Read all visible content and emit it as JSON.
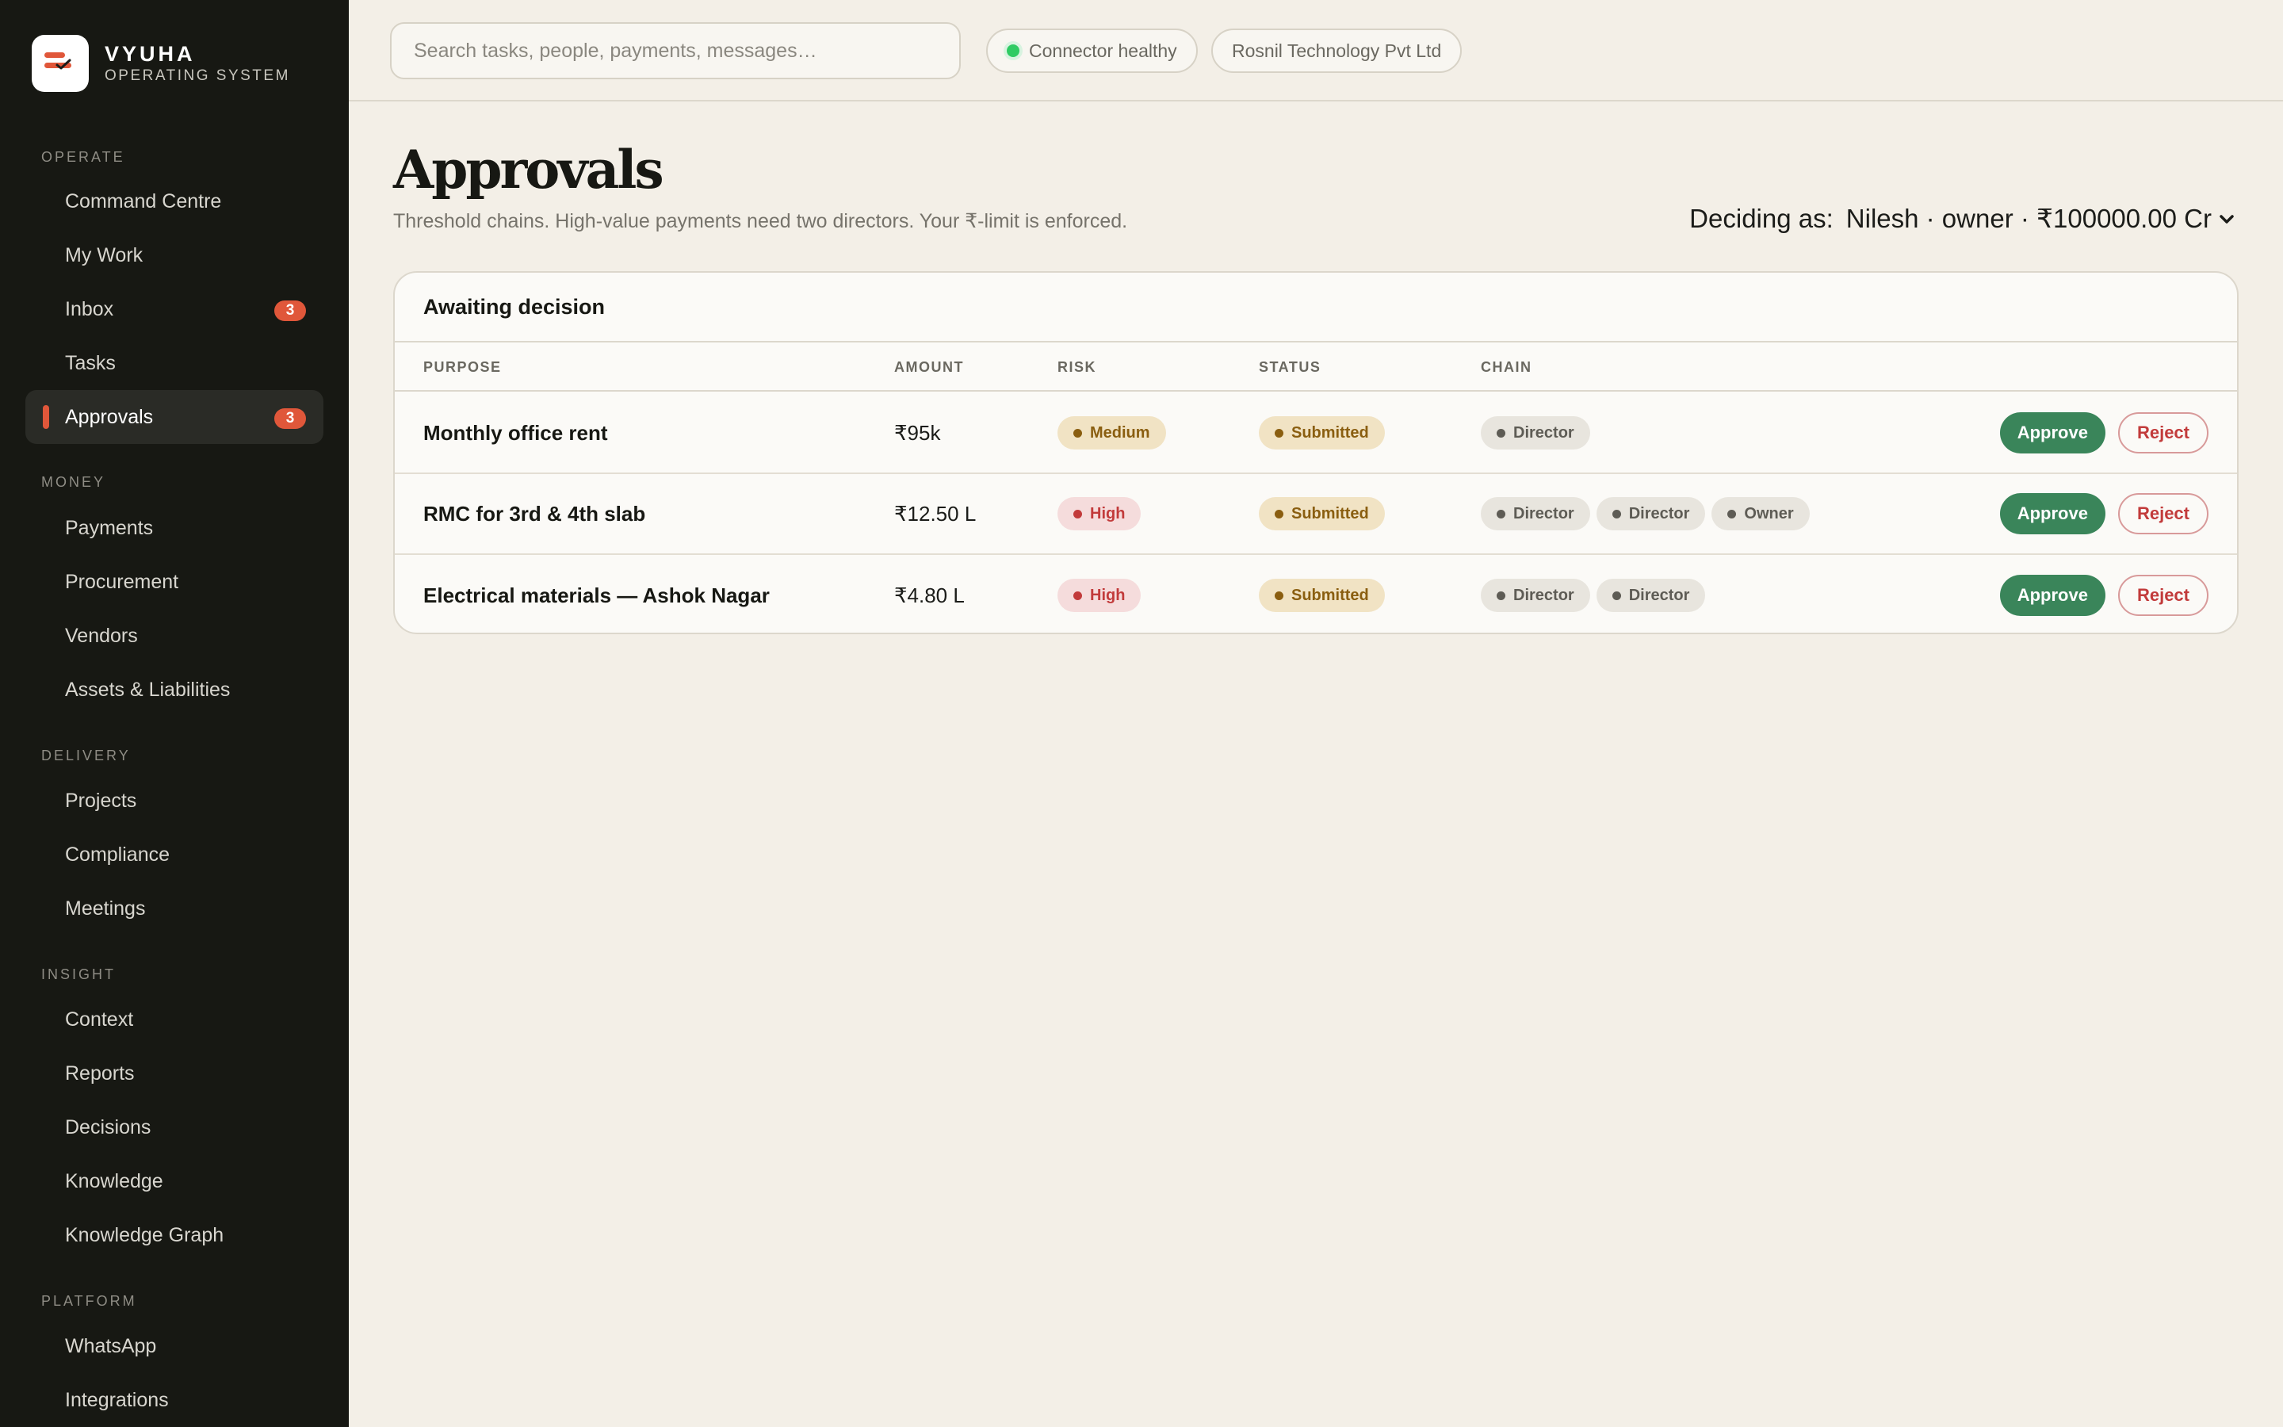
{
  "brand": {
    "name": "VYUHA",
    "subtitle": "OPERATING SYSTEM"
  },
  "sidebar": {
    "sections": [
      {
        "title": "OPERATE",
        "items": [
          {
            "label": "Command Centre"
          },
          {
            "label": "My Work"
          },
          {
            "label": "Inbox",
            "badge": "3"
          },
          {
            "label": "Tasks"
          },
          {
            "label": "Approvals",
            "badge": "3",
            "active": true
          }
        ]
      },
      {
        "title": "MONEY",
        "items": [
          {
            "label": "Payments"
          },
          {
            "label": "Procurement"
          },
          {
            "label": "Vendors"
          },
          {
            "label": "Assets & Liabilities"
          }
        ]
      },
      {
        "title": "DELIVERY",
        "items": [
          {
            "label": "Projects"
          },
          {
            "label": "Compliance"
          },
          {
            "label": "Meetings"
          }
        ]
      },
      {
        "title": "INSIGHT",
        "items": [
          {
            "label": "Context"
          },
          {
            "label": "Reports"
          },
          {
            "label": "Decisions"
          },
          {
            "label": "Knowledge"
          },
          {
            "label": "Knowledge Graph"
          }
        ]
      },
      {
        "title": "PLATFORM",
        "items": [
          {
            "label": "WhatsApp"
          },
          {
            "label": "Integrations"
          }
        ]
      }
    ]
  },
  "topbar": {
    "search_placeholder": "Search tasks, people, payments, messages…",
    "connector_status": "Connector healthy",
    "company": "Rosnil Technology Pvt Ltd"
  },
  "page": {
    "title": "Approvals",
    "subtitle": "Threshold chains. High-value payments need two directors. Your ₹-limit is enforced.",
    "deciding_label": "Deciding as:",
    "deciding_value": "Nilesh · owner · ₹100000.00 Cr"
  },
  "table": {
    "heading": "Awaiting decision",
    "columns": {
      "purpose": "PURPOSE",
      "amount": "AMOUNT",
      "risk": "RISK",
      "status": "STATUS",
      "chain": "CHAIN"
    },
    "approve_label": "Approve",
    "reject_label": "Reject",
    "rows": [
      {
        "purpose": "Monthly office rent",
        "amount": "₹95k",
        "risk": "Medium",
        "risk_level": "medium",
        "status": "Submitted",
        "chain": [
          "Director"
        ]
      },
      {
        "purpose": "RMC for 3rd & 4th slab",
        "amount": "₹12.50 L",
        "risk": "High",
        "risk_level": "high",
        "status": "Submitted",
        "chain": [
          "Director",
          "Director",
          "Owner"
        ]
      },
      {
        "purpose": "Electrical materials — Ashok Nagar",
        "amount": "₹4.80 L",
        "risk": "High",
        "risk_level": "high",
        "status": "Submitted",
        "chain": [
          "Director",
          "Director"
        ]
      }
    ]
  },
  "colors": {
    "accent": "#e0573a",
    "approve": "#3a855a",
    "sidebar_bg": "#171813",
    "page_bg": "#f3efe7"
  }
}
